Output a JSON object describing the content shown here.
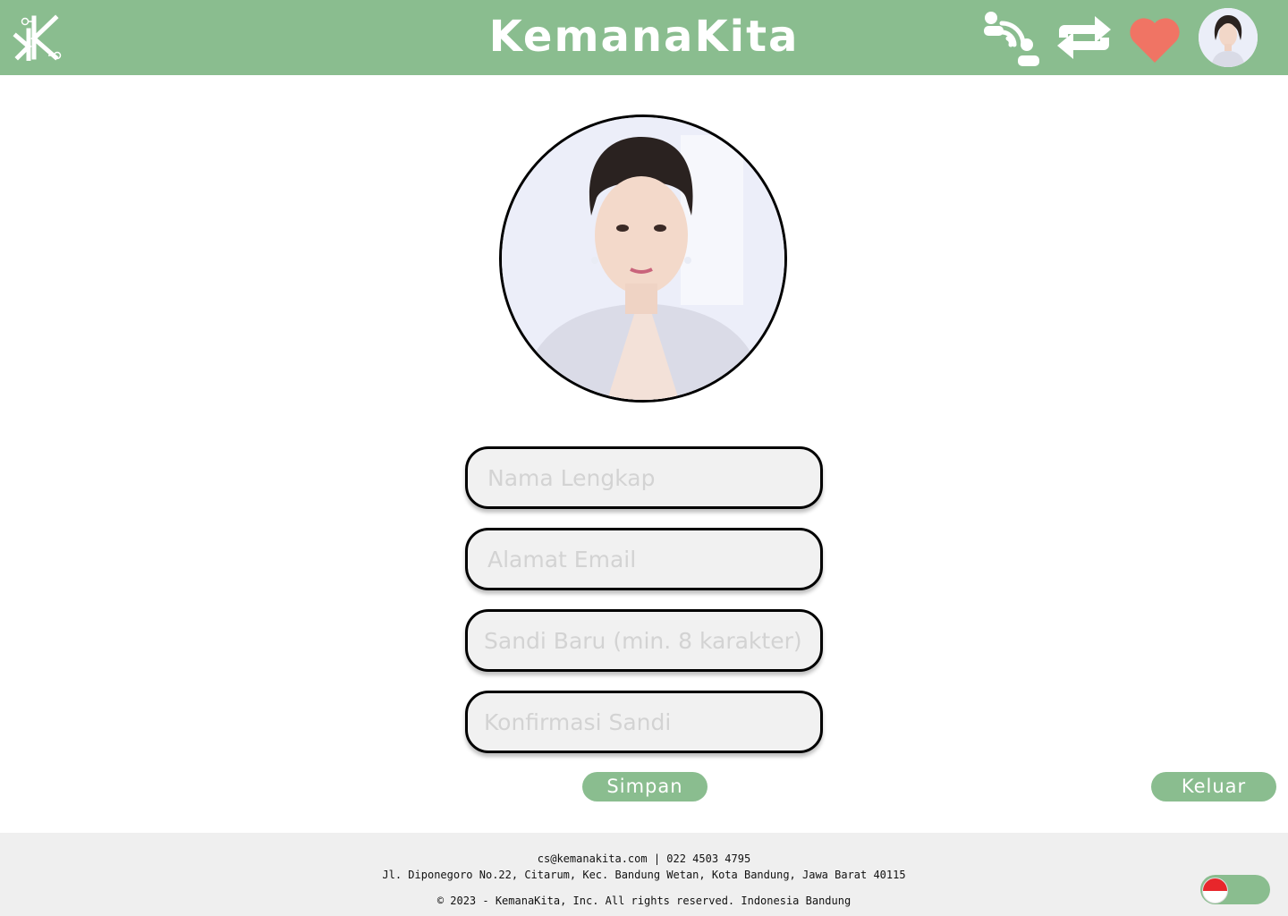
{
  "header": {
    "app_title": "KemanaKita",
    "logo_icon": "kk-logo-icon",
    "nav_icons": [
      "travelers-wifi-icon",
      "swap-arrows-icon",
      "heart-icon"
    ],
    "avatar": "user-avatar"
  },
  "profile": {
    "photo": "profile-photo"
  },
  "form": {
    "full_name_placeholder": "Nama Lengkap",
    "email_placeholder": "Alamat Email",
    "new_password_placeholder": "Sandi Baru (min. 8 karakter)",
    "confirm_password_placeholder": "Konfirmasi Sandi",
    "save_label": "Simpan"
  },
  "logout_label": "Keluar",
  "footer": {
    "contact": "cs@kemanakita.com | 022 4503 4795",
    "address": "Jl. Diponegoro No.22, Citarum, Kec. Bandung Wetan, Kota Bandung, Jawa Barat 40115",
    "copyright": "© 2023 - KemanaKita, Inc. All rights reserved. Indonesia Bandung",
    "language_flag": "indonesia-flag-icon"
  },
  "colors": {
    "brand_green": "#8abd8f",
    "heart_red": "#f07464",
    "field_bg": "#f1f1f1",
    "footer_bg": "#efefef"
  }
}
